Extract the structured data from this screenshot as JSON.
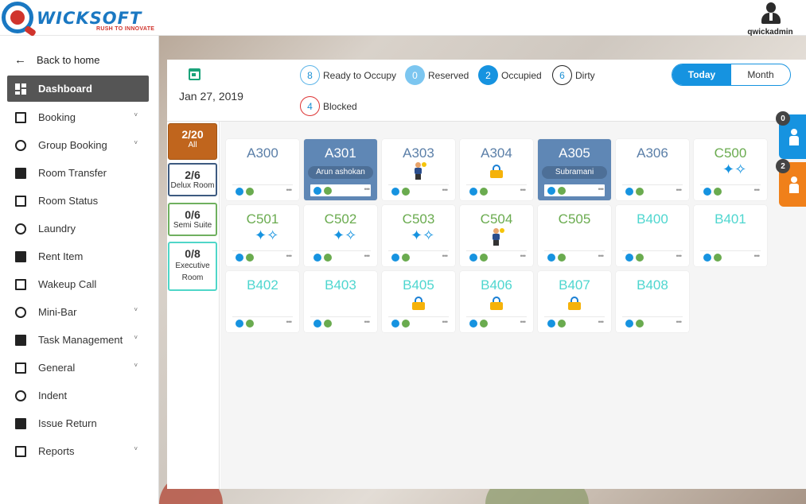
{
  "app": {
    "brand": "WICKSOFT",
    "tagline": "RUSH TO INNOVATE",
    "username": "qwickadmin"
  },
  "sidebar": {
    "back_label": "Back to home",
    "items": [
      {
        "label": "Dashboard",
        "icon": "dashboard-icon",
        "active": true,
        "chevron": false
      },
      {
        "label": "Booking",
        "icon": "bed-icon",
        "chevron": true
      },
      {
        "label": "Group Booking",
        "icon": "group-booking-icon",
        "chevron": true
      },
      {
        "label": "Room Transfer",
        "icon": "crop-icon",
        "chevron": false
      },
      {
        "label": "Room Status",
        "icon": "paint-roller-icon",
        "chevron": false
      },
      {
        "label": "Laundry",
        "icon": "laundry-icon",
        "chevron": false
      },
      {
        "label": "Rent Item",
        "icon": "rent-item-icon",
        "chevron": false
      },
      {
        "label": "Wakeup Call",
        "icon": "alarm-clock-icon",
        "chevron": false
      },
      {
        "label": "Mini-Bar",
        "icon": "mini-bar-icon",
        "chevron": true
      },
      {
        "label": "Task Management",
        "icon": "task-icon",
        "chevron": true
      },
      {
        "label": "General",
        "icon": "general-icon",
        "chevron": true
      },
      {
        "label": "Indent",
        "icon": "add-box-icon",
        "chevron": false
      },
      {
        "label": "Issue Return",
        "icon": "minus-box-icon",
        "chevron": false
      },
      {
        "label": "Reports",
        "icon": "reports-icon",
        "chevron": true
      }
    ]
  },
  "header": {
    "date": "Jan 27, 2019",
    "stats": [
      {
        "key": "ready",
        "count": "8",
        "label": "Ready to Occupy"
      },
      {
        "key": "reserved",
        "count": "0",
        "label": "Reserved"
      },
      {
        "key": "occupied",
        "count": "2",
        "label": "Occupied"
      },
      {
        "key": "dirty",
        "count": "6",
        "label": "Dirty"
      },
      {
        "key": "blocked",
        "count": "4",
        "label": "Blocked"
      }
    ],
    "toggle": {
      "today": "Today",
      "month": "Month",
      "selected": "Today"
    }
  },
  "filters": [
    {
      "count": "2/20",
      "label": "All"
    },
    {
      "count": "2/6",
      "label": "Delux Room"
    },
    {
      "count": "0/6",
      "label": "Semi Suite"
    },
    {
      "count": "0/8",
      "label": "Executive Room"
    }
  ],
  "rooms": [
    {
      "number": "A300",
      "type": "blue",
      "status": "ready",
      "guest": ""
    },
    {
      "number": "A301",
      "type": "blue",
      "status": "occupied",
      "guest": "Arun ashokan"
    },
    {
      "number": "A303",
      "type": "blue",
      "status": "cleaning",
      "guest": ""
    },
    {
      "number": "A304",
      "type": "blue",
      "status": "blocked",
      "guest": ""
    },
    {
      "number": "A305",
      "type": "blue",
      "status": "occupied",
      "guest": "Subramani"
    },
    {
      "number": "A306",
      "type": "blue",
      "status": "ready",
      "guest": ""
    },
    {
      "number": "C500",
      "type": "green",
      "status": "dirty",
      "guest": ""
    },
    {
      "number": "C501",
      "type": "green",
      "status": "dirty",
      "guest": ""
    },
    {
      "number": "C502",
      "type": "green",
      "status": "dirty",
      "guest": ""
    },
    {
      "number": "C503",
      "type": "green",
      "status": "dirty",
      "guest": ""
    },
    {
      "number": "C504",
      "type": "green",
      "status": "cleaning",
      "guest": ""
    },
    {
      "number": "C505",
      "type": "green",
      "status": "ready",
      "guest": ""
    },
    {
      "number": "B400",
      "type": "teal",
      "status": "ready",
      "guest": ""
    },
    {
      "number": "B401",
      "type": "teal",
      "status": "ready",
      "guest": ""
    },
    {
      "number": "B402",
      "type": "teal",
      "status": "ready",
      "guest": ""
    },
    {
      "number": "B403",
      "type": "teal",
      "status": "ready",
      "guest": ""
    },
    {
      "number": "B405",
      "type": "teal",
      "status": "blocked",
      "guest": ""
    },
    {
      "number": "B406",
      "type": "teal",
      "status": "blocked",
      "guest": ""
    },
    {
      "number": "B407",
      "type": "teal",
      "status": "blocked",
      "guest": ""
    },
    {
      "number": "B408",
      "type": "teal",
      "status": "ready",
      "guest": ""
    }
  ],
  "side_buttons": [
    {
      "count": "0",
      "icon": "reception-icon",
      "color": "#1693e0"
    },
    {
      "count": "2",
      "icon": "luggage-icon",
      "color": "#f0801a"
    }
  ]
}
